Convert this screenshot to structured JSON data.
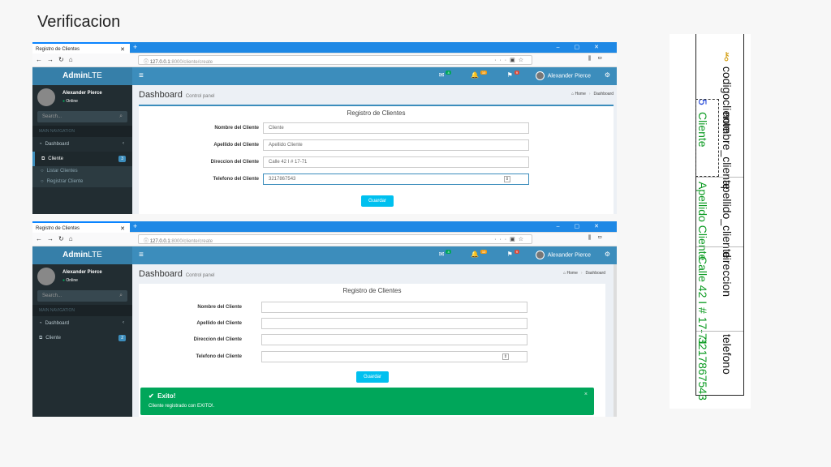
{
  "slide": {
    "title": "Verificacion"
  },
  "browser": {
    "tab_title": "Registro de Clientes",
    "url_host": "127.0.0.1",
    "url_rest": ":8000/cliente/create"
  },
  "app": {
    "brand_bold": "Admin",
    "brand_rest": "LTE",
    "badges": {
      "mail": "4",
      "bell": "10",
      "flag": "9"
    },
    "user_name": "Alexander Pierce",
    "user_status": "Online",
    "search_placeholder": "Search...",
    "nav_header": "MAIN NAVIGATION",
    "nav": {
      "dashboard": "Dashboard",
      "cliente": "Cliente",
      "cliente_count": "3",
      "cliente_count2": "2",
      "listar": "Listar Clientes",
      "registrar": "Registrar Cliente"
    },
    "page_title": "Dashboard",
    "page_subtitle": "Control panel",
    "crumb_home": "Home",
    "crumb_current": "Dashboard"
  },
  "form": {
    "title": "Registro de Clientes",
    "labels": {
      "nombre": "Nombre del Cliente",
      "apellido": "Apellido del Cliente",
      "direccion": "Direccion del Cliente",
      "telefono": "Telefono del Cliente"
    },
    "values": {
      "nombre": "Cliente",
      "apellido": "Apellido Cliente",
      "direccion": "Calle 42 I # 17-71",
      "telefono": "3217867543"
    },
    "submit": "Guardar"
  },
  "alert": {
    "title": "Exito!",
    "message": "Cliente registrado con EXITO!."
  },
  "db": {
    "columns": [
      "codigocliente",
      "nombre_cliente",
      "apellido_cliente",
      "direccion",
      "telefono"
    ],
    "row": [
      "5",
      "Cliente",
      "Apellido Cliente",
      "Calle 42 I # 17-71",
      "3217867543"
    ]
  }
}
